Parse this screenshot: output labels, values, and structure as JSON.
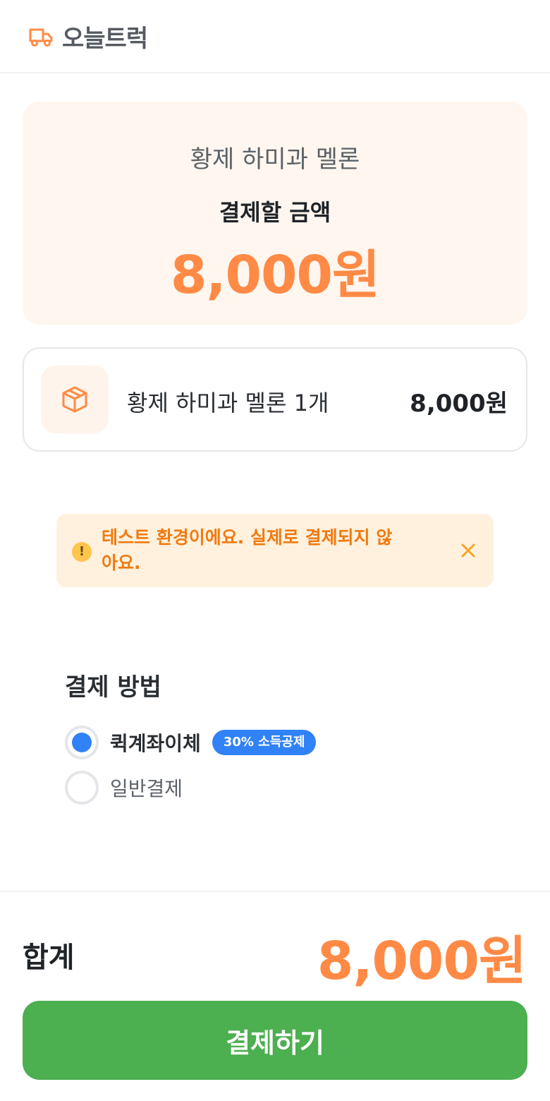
{
  "header": {
    "brand": "오늘트럭",
    "icon": "truck-icon"
  },
  "summary": {
    "product_name": "황제 하미과 멜론",
    "amount_label": "결제할 금액",
    "amount": "8,000원"
  },
  "item": {
    "icon": "box-icon",
    "name": "황제 하미과 멜론 1개",
    "price": "8,000원"
  },
  "notice": {
    "icon": "warning-icon",
    "message": "테스트 환경이에요. 실제로 결제되지 않아요."
  },
  "payment": {
    "title": "결제 방법",
    "options": [
      {
        "label": "퀵계좌이체",
        "badge": "30% 소득공제",
        "selected": true
      },
      {
        "label": "일반결제",
        "selected": false
      }
    ]
  },
  "footer": {
    "total_label": "합계",
    "total_amount": "8,000원",
    "pay_button": "결제하기"
  },
  "colors": {
    "accent": "#ff8a45",
    "primary_button": "#4caf50",
    "radio_selected": "#3182f6",
    "notice_bg": "#fff1de",
    "notice_text": "#f07a10"
  }
}
